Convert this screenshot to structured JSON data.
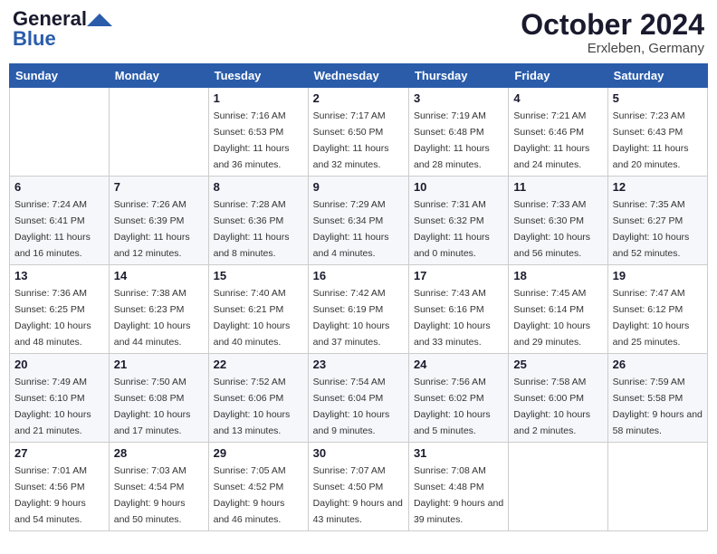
{
  "header": {
    "logo_line1": "General",
    "logo_line2": "Blue",
    "month": "October 2024",
    "location": "Erxleben, Germany"
  },
  "weekdays": [
    "Sunday",
    "Monday",
    "Tuesday",
    "Wednesday",
    "Thursday",
    "Friday",
    "Saturday"
  ],
  "weeks": [
    [
      {
        "day": "",
        "detail": ""
      },
      {
        "day": "",
        "detail": ""
      },
      {
        "day": "1",
        "detail": "Sunrise: 7:16 AM\nSunset: 6:53 PM\nDaylight: 11 hours and 36 minutes."
      },
      {
        "day": "2",
        "detail": "Sunrise: 7:17 AM\nSunset: 6:50 PM\nDaylight: 11 hours and 32 minutes."
      },
      {
        "day": "3",
        "detail": "Sunrise: 7:19 AM\nSunset: 6:48 PM\nDaylight: 11 hours and 28 minutes."
      },
      {
        "day": "4",
        "detail": "Sunrise: 7:21 AM\nSunset: 6:46 PM\nDaylight: 11 hours and 24 minutes."
      },
      {
        "day": "5",
        "detail": "Sunrise: 7:23 AM\nSunset: 6:43 PM\nDaylight: 11 hours and 20 minutes."
      }
    ],
    [
      {
        "day": "6",
        "detail": "Sunrise: 7:24 AM\nSunset: 6:41 PM\nDaylight: 11 hours and 16 minutes."
      },
      {
        "day": "7",
        "detail": "Sunrise: 7:26 AM\nSunset: 6:39 PM\nDaylight: 11 hours and 12 minutes."
      },
      {
        "day": "8",
        "detail": "Sunrise: 7:28 AM\nSunset: 6:36 PM\nDaylight: 11 hours and 8 minutes."
      },
      {
        "day": "9",
        "detail": "Sunrise: 7:29 AM\nSunset: 6:34 PM\nDaylight: 11 hours and 4 minutes."
      },
      {
        "day": "10",
        "detail": "Sunrise: 7:31 AM\nSunset: 6:32 PM\nDaylight: 11 hours and 0 minutes."
      },
      {
        "day": "11",
        "detail": "Sunrise: 7:33 AM\nSunset: 6:30 PM\nDaylight: 10 hours and 56 minutes."
      },
      {
        "day": "12",
        "detail": "Sunrise: 7:35 AM\nSunset: 6:27 PM\nDaylight: 10 hours and 52 minutes."
      }
    ],
    [
      {
        "day": "13",
        "detail": "Sunrise: 7:36 AM\nSunset: 6:25 PM\nDaylight: 10 hours and 48 minutes."
      },
      {
        "day": "14",
        "detail": "Sunrise: 7:38 AM\nSunset: 6:23 PM\nDaylight: 10 hours and 44 minutes."
      },
      {
        "day": "15",
        "detail": "Sunrise: 7:40 AM\nSunset: 6:21 PM\nDaylight: 10 hours and 40 minutes."
      },
      {
        "day": "16",
        "detail": "Sunrise: 7:42 AM\nSunset: 6:19 PM\nDaylight: 10 hours and 37 minutes."
      },
      {
        "day": "17",
        "detail": "Sunrise: 7:43 AM\nSunset: 6:16 PM\nDaylight: 10 hours and 33 minutes."
      },
      {
        "day": "18",
        "detail": "Sunrise: 7:45 AM\nSunset: 6:14 PM\nDaylight: 10 hours and 29 minutes."
      },
      {
        "day": "19",
        "detail": "Sunrise: 7:47 AM\nSunset: 6:12 PM\nDaylight: 10 hours and 25 minutes."
      }
    ],
    [
      {
        "day": "20",
        "detail": "Sunrise: 7:49 AM\nSunset: 6:10 PM\nDaylight: 10 hours and 21 minutes."
      },
      {
        "day": "21",
        "detail": "Sunrise: 7:50 AM\nSunset: 6:08 PM\nDaylight: 10 hours and 17 minutes."
      },
      {
        "day": "22",
        "detail": "Sunrise: 7:52 AM\nSunset: 6:06 PM\nDaylight: 10 hours and 13 minutes."
      },
      {
        "day": "23",
        "detail": "Sunrise: 7:54 AM\nSunset: 6:04 PM\nDaylight: 10 hours and 9 minutes."
      },
      {
        "day": "24",
        "detail": "Sunrise: 7:56 AM\nSunset: 6:02 PM\nDaylight: 10 hours and 5 minutes."
      },
      {
        "day": "25",
        "detail": "Sunrise: 7:58 AM\nSunset: 6:00 PM\nDaylight: 10 hours and 2 minutes."
      },
      {
        "day": "26",
        "detail": "Sunrise: 7:59 AM\nSunset: 5:58 PM\nDaylight: 9 hours and 58 minutes."
      }
    ],
    [
      {
        "day": "27",
        "detail": "Sunrise: 7:01 AM\nSunset: 4:56 PM\nDaylight: 9 hours and 54 minutes."
      },
      {
        "day": "28",
        "detail": "Sunrise: 7:03 AM\nSunset: 4:54 PM\nDaylight: 9 hours and 50 minutes."
      },
      {
        "day": "29",
        "detail": "Sunrise: 7:05 AM\nSunset: 4:52 PM\nDaylight: 9 hours and 46 minutes."
      },
      {
        "day": "30",
        "detail": "Sunrise: 7:07 AM\nSunset: 4:50 PM\nDaylight: 9 hours and 43 minutes."
      },
      {
        "day": "31",
        "detail": "Sunrise: 7:08 AM\nSunset: 4:48 PM\nDaylight: 9 hours and 39 minutes."
      },
      {
        "day": "",
        "detail": ""
      },
      {
        "day": "",
        "detail": ""
      }
    ]
  ]
}
